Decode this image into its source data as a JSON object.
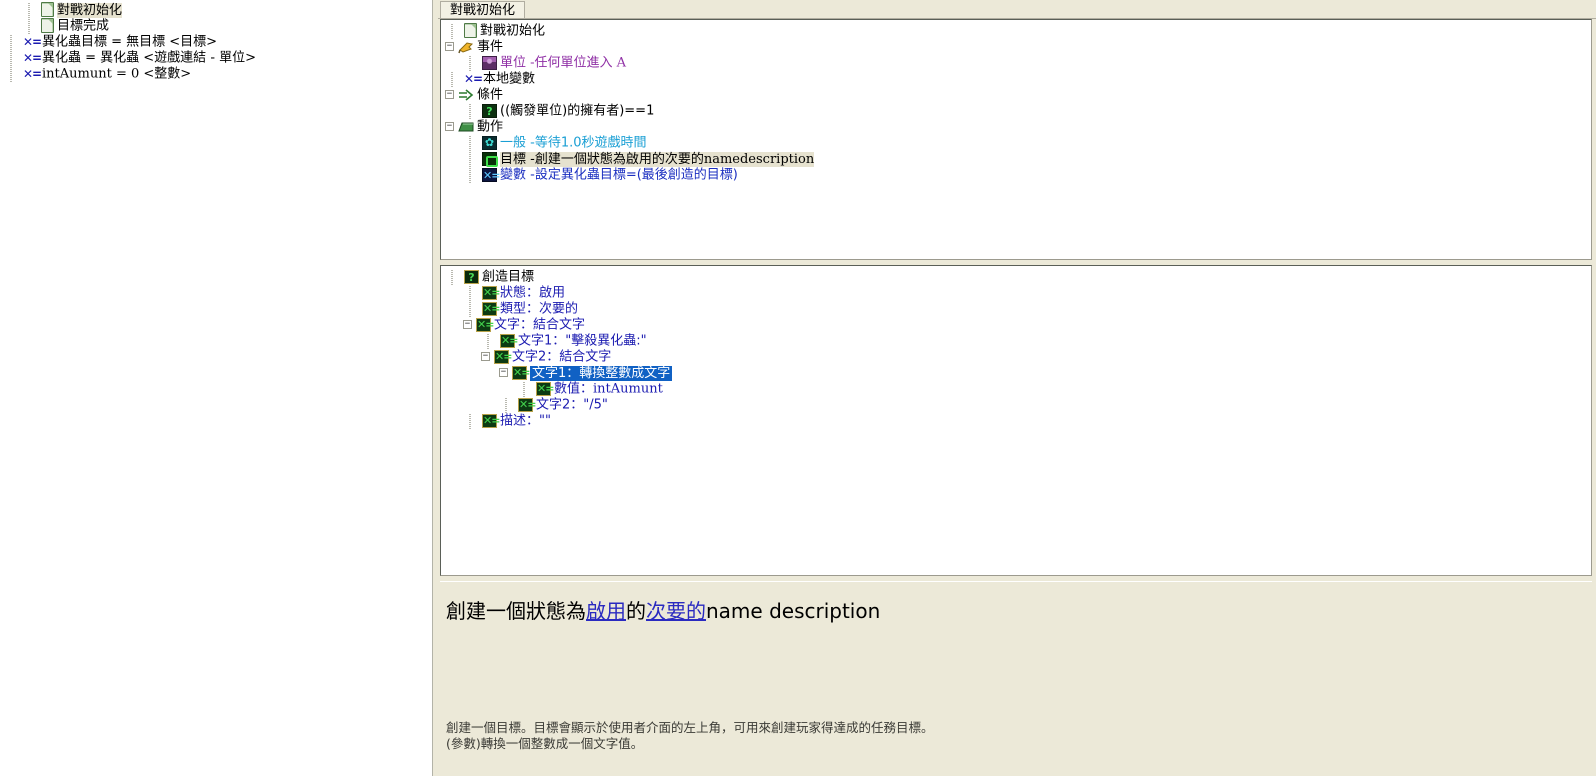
{
  "window": {
    "tab_label": "對戰初始化"
  },
  "left_tree": {
    "items": [
      {
        "icon": "document-icon",
        "label": "對戰初始化",
        "selected": true,
        "indent": 1
      },
      {
        "icon": "document-icon",
        "label": "目標完成",
        "selected": false,
        "indent": 1
      },
      {
        "icon": "variable-icon",
        "label": "異化蟲目標 = 無目標 <目標>",
        "selected": false,
        "indent": 0
      },
      {
        "icon": "variable-icon",
        "label": "異化蟲 = 異化蟲 <遊戲連結 - 單位>",
        "selected": false,
        "indent": 0
      },
      {
        "icon": "variable-icon",
        "label": "intAumunt = 0 <整數>",
        "selected": false,
        "indent": 0,
        "serif": true
      }
    ]
  },
  "trigger_tree": {
    "nodes": [
      {
        "indent": 0,
        "expander": "none",
        "icon": "document-icon",
        "label": "對戰初始化",
        "color": "black"
      },
      {
        "indent": 0,
        "expander": "minus",
        "icon": "flag-icon",
        "label": "事件",
        "color": "black"
      },
      {
        "indent": 1,
        "expander": "none",
        "icon": "unit-icon",
        "prefix": "單位",
        "prefix_color": "purple",
        "label": "-任何單位進入 A",
        "color": "purple",
        "serif_tail": true
      },
      {
        "indent": 0,
        "expander": "none",
        "icon": "variable-icon",
        "label": "本地變數",
        "color": "black"
      },
      {
        "indent": 0,
        "expander": "minus",
        "icon": "arrow-icon",
        "label": "條件",
        "color": "black"
      },
      {
        "indent": 1,
        "expander": "none",
        "icon": "question-icon",
        "label": "((觸發單位)的擁有者)==1",
        "color": "black"
      },
      {
        "indent": 0,
        "expander": "minus",
        "icon": "action-icon",
        "label": "動作",
        "color": "black"
      },
      {
        "indent": 1,
        "expander": "none",
        "icon": "gear-icon",
        "prefix": "一般",
        "prefix_color": "cyan",
        "label": "-等待1.0秒遊戲時間",
        "color": "cyan"
      },
      {
        "indent": 1,
        "expander": "none",
        "icon": "goal-icon",
        "prefix": "目標",
        "prefix_color": "black",
        "label": "-創建一個狀態為啟用的次要的",
        "tail": "namedescription",
        "color": "black",
        "highlight": true
      },
      {
        "indent": 1,
        "expander": "none",
        "icon": "setvar-icon",
        "prefix": "變數",
        "prefix_color": "blue",
        "label": "-設定異化蟲目標=(最後創造的目標)",
        "color": "blue"
      }
    ]
  },
  "param_tree": {
    "nodes": [
      {
        "indent": 0,
        "expander": "none",
        "icon": "question-green-icon",
        "label": "創造目標",
        "color": "black"
      },
      {
        "indent": 1,
        "expander": "none",
        "icon": "greenx-icon",
        "label": "狀態：啟用",
        "color": "navy"
      },
      {
        "indent": 1,
        "expander": "none",
        "icon": "greenx-icon",
        "label": "類型：次要的",
        "color": "navy"
      },
      {
        "indent": 1,
        "expander": "minus",
        "icon": "greenx-icon",
        "label": "文字：結合文字",
        "color": "navy"
      },
      {
        "indent": 2,
        "expander": "none",
        "icon": "greenx-icon",
        "label": "文字1：\"擊殺異化蟲:\"",
        "color": "navy"
      },
      {
        "indent": 2,
        "expander": "minus",
        "icon": "greenx-icon",
        "label": "文字2：結合文字",
        "color": "navy"
      },
      {
        "indent": 3,
        "expander": "minus",
        "icon": "greenx-icon",
        "label": "文字1：轉換整數成文字",
        "color": "navy",
        "selected": true
      },
      {
        "indent": 4,
        "expander": "none",
        "icon": "greenx-icon",
        "label": "數值：intAumunt",
        "color": "navy",
        "serif_tail": true
      },
      {
        "indent": 3,
        "expander": "none",
        "icon": "greenx-icon",
        "label": "文字2：\"/5\"",
        "color": "navy"
      },
      {
        "indent": 1,
        "expander": "none",
        "icon": "greenx-icon",
        "label": "描述：\"\"",
        "color": "navy"
      }
    ]
  },
  "description": {
    "sentence_parts": [
      {
        "text": "創建一個狀態為",
        "link": false
      },
      {
        "text": "啟用",
        "link": true
      },
      {
        "text": "的",
        "link": false
      },
      {
        "text": "次要的",
        "link": true
      },
      {
        "text": "name description",
        "link": false
      }
    ],
    "help_lines": [
      "創建一個目標。目標會顯示於使用者介面的左上角，可用來創建玩家得達成的任務目標。",
      "(參數)轉換一個整數成一個文字值。"
    ]
  },
  "colors": {
    "selection_blue": "#1061c4",
    "panel_beige": "#ece9d8",
    "action_highlight": "#e6e2cf",
    "link_blue": "#2a2ac0",
    "purple_text": "#8f2fa5",
    "cyan_text": "#1a9fd4",
    "navy_text": "#1b1bb0"
  }
}
